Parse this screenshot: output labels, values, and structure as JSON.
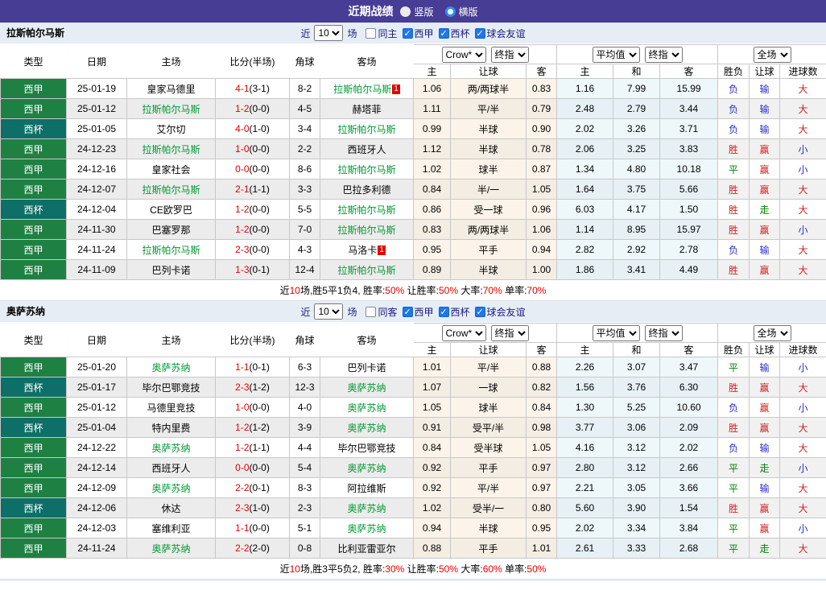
{
  "titlebar": {
    "title": "近期战绩",
    "radios": [
      {
        "label": "竖版",
        "selected": false
      },
      {
        "label": "横版",
        "selected": true
      }
    ]
  },
  "table_header": {
    "type": "类型",
    "date": "日期",
    "home": "主场",
    "score": "比分(半场)",
    "corner": "角球",
    "away": "客场",
    "group_selects": {
      "book": "Crow*",
      "book_stage": "终指",
      "avg": "平均值",
      "avg_stage": "终指",
      "scope": "全场"
    },
    "odds_sub": [
      "主",
      "让球",
      "客"
    ],
    "avg_sub": [
      "主",
      "和",
      "客"
    ],
    "result_sub": [
      "胜负",
      "让球",
      "进球数"
    ]
  },
  "result_color_map": {
    "胜": "#CC2222",
    "赢": "#CC2222",
    "大": "#CC2222",
    "平": "#008000",
    "走": "#008000",
    "负": "#2A2ACC",
    "输": "#2A2ACC",
    "小": "#2A2ACC"
  },
  "type_color_map": {
    "西甲": "#1E8143",
    "西杯": "#0E6F68"
  },
  "sections": [
    {
      "team": "拉斯帕尔马斯",
      "filter": {
        "near": "近",
        "count": "10",
        "unit": "场",
        "checks": [
          {
            "label": "同主",
            "checked": false
          },
          {
            "label": "西甲",
            "checked": true
          },
          {
            "label": "西杯",
            "checked": true
          },
          {
            "label": "球会友谊",
            "checked": true
          }
        ]
      },
      "rows": [
        {
          "type": "西甲",
          "date": "25-01-19",
          "home": "皇家马德里",
          "home_self": false,
          "home_badge": "",
          "score": "4-1",
          "half": "(3-1)",
          "corner": "8-2",
          "away": "拉斯帕尔马斯",
          "away_self": true,
          "away_badge": "1",
          "odds": [
            "1.06",
            "两/两球半",
            "0.83"
          ],
          "avg": [
            "1.16",
            "7.99",
            "15.99"
          ],
          "res": [
            "负",
            "输",
            "大"
          ]
        },
        {
          "type": "西甲",
          "date": "25-01-12",
          "home": "拉斯帕尔马斯",
          "home_self": true,
          "home_badge": "",
          "score": "1-2",
          "half": "(0-0)",
          "corner": "4-5",
          "away": "赫塔菲",
          "away_self": false,
          "away_badge": "",
          "odds": [
            "1.11",
            "平/半",
            "0.79"
          ],
          "avg": [
            "2.48",
            "2.79",
            "3.44"
          ],
          "res": [
            "负",
            "输",
            "大"
          ]
        },
        {
          "type": "西杯",
          "date": "25-01-05",
          "home": "艾尔切",
          "home_self": false,
          "home_badge": "",
          "score": "4-0",
          "half": "(1-0)",
          "corner": "3-4",
          "away": "拉斯帕尔马斯",
          "away_self": true,
          "away_badge": "",
          "odds": [
            "0.99",
            "半球",
            "0.90"
          ],
          "avg": [
            "2.02",
            "3.26",
            "3.71"
          ],
          "res": [
            "负",
            "输",
            "大"
          ]
        },
        {
          "type": "西甲",
          "date": "24-12-23",
          "home": "拉斯帕尔马斯",
          "home_self": true,
          "home_badge": "",
          "score": "1-0",
          "half": "(0-0)",
          "corner": "2-2",
          "away": "西班牙人",
          "away_self": false,
          "away_badge": "",
          "odds": [
            "1.12",
            "半球",
            "0.78"
          ],
          "avg": [
            "2.06",
            "3.25",
            "3.83"
          ],
          "res": [
            "胜",
            "赢",
            "小"
          ]
        },
        {
          "type": "西甲",
          "date": "24-12-16",
          "home": "皇家社会",
          "home_self": false,
          "home_badge": "",
          "score": "0-0",
          "half": "(0-0)",
          "corner": "8-6",
          "away": "拉斯帕尔马斯",
          "away_self": true,
          "away_badge": "",
          "odds": [
            "1.02",
            "球半",
            "0.87"
          ],
          "avg": [
            "1.34",
            "4.80",
            "10.18"
          ],
          "res": [
            "平",
            "赢",
            "小"
          ]
        },
        {
          "type": "西甲",
          "date": "24-12-07",
          "home": "拉斯帕尔马斯",
          "home_self": true,
          "home_badge": "",
          "score": "2-1",
          "half": "(1-1)",
          "corner": "3-3",
          "away": "巴拉多利德",
          "away_self": false,
          "away_badge": "",
          "odds": [
            "0.84",
            "半/一",
            "1.05"
          ],
          "avg": [
            "1.64",
            "3.75",
            "5.66"
          ],
          "res": [
            "胜",
            "赢",
            "大"
          ]
        },
        {
          "type": "西杯",
          "date": "24-12-04",
          "home": "CE欧罗巴",
          "home_self": false,
          "home_badge": "",
          "score": "1-2",
          "half": "(0-0)",
          "corner": "5-5",
          "away": "拉斯帕尔马斯",
          "away_self": true,
          "away_badge": "",
          "odds": [
            "0.86",
            "受一球",
            "0.96"
          ],
          "avg": [
            "6.03",
            "4.17",
            "1.50"
          ],
          "res": [
            "胜",
            "走",
            "大"
          ]
        },
        {
          "type": "西甲",
          "date": "24-11-30",
          "home": "巴塞罗那",
          "home_self": false,
          "home_badge": "",
          "score": "1-2",
          "half": "(0-0)",
          "corner": "7-0",
          "away": "拉斯帕尔马斯",
          "away_self": true,
          "away_badge": "",
          "odds": [
            "0.83",
            "两/两球半",
            "1.06"
          ],
          "avg": [
            "1.14",
            "8.95",
            "15.97"
          ],
          "res": [
            "胜",
            "赢",
            "小"
          ]
        },
        {
          "type": "西甲",
          "date": "24-11-24",
          "home": "拉斯帕尔马斯",
          "home_self": true,
          "home_badge": "",
          "score": "2-3",
          "half": "(0-0)",
          "corner": "4-3",
          "away": "马洛卡",
          "away_self": false,
          "away_badge": "1",
          "odds": [
            "0.95",
            "平手",
            "0.94"
          ],
          "avg": [
            "2.82",
            "2.92",
            "2.78"
          ],
          "res": [
            "负",
            "输",
            "大"
          ]
        },
        {
          "type": "西甲",
          "date": "24-11-09",
          "home": "巴列卡诺",
          "home_self": false,
          "home_badge": "",
          "score": "1-3",
          "half": "(0-1)",
          "corner": "12-4",
          "away": "拉斯帕尔马斯",
          "away_self": true,
          "away_badge": "",
          "odds": [
            "0.89",
            "半球",
            "1.00"
          ],
          "avg": [
            "1.86",
            "3.41",
            "4.49"
          ],
          "res": [
            "胜",
            "赢",
            "大"
          ]
        }
      ],
      "summary": [
        {
          "t": "近",
          "c": "k"
        },
        {
          "t": "10",
          "c": "r"
        },
        {
          "t": "场,胜5平1负4, 胜率:",
          "c": "k"
        },
        {
          "t": "50%",
          "c": "r"
        },
        {
          "t": " 让胜率:",
          "c": "k"
        },
        {
          "t": "50%",
          "c": "r"
        },
        {
          "t": " 大率:",
          "c": "k"
        },
        {
          "t": "70%",
          "c": "r"
        },
        {
          "t": " 单率:",
          "c": "k"
        },
        {
          "t": "70%",
          "c": "r"
        }
      ]
    },
    {
      "team": "奥萨苏纳",
      "filter": {
        "near": "近",
        "count": "10",
        "unit": "场",
        "checks": [
          {
            "label": "同客",
            "checked": false
          },
          {
            "label": "西甲",
            "checked": true
          },
          {
            "label": "西杯",
            "checked": true
          },
          {
            "label": "球会友谊",
            "checked": true
          }
        ]
      },
      "rows": [
        {
          "type": "西甲",
          "date": "25-01-20",
          "home": "奥萨苏纳",
          "home_self": true,
          "home_badge": "",
          "score": "1-1",
          "half": "(0-1)",
          "corner": "6-3",
          "away": "巴列卡诺",
          "away_self": false,
          "away_badge": "",
          "odds": [
            "1.01",
            "平/半",
            "0.88"
          ],
          "avg": [
            "2.26",
            "3.07",
            "3.47"
          ],
          "res": [
            "平",
            "输",
            "小"
          ]
        },
        {
          "type": "西杯",
          "date": "25-01-17",
          "home": "毕尔巴鄂竞技",
          "home_self": false,
          "home_badge": "",
          "score": "2-3",
          "half": "(1-2)",
          "corner": "12-3",
          "away": "奥萨苏纳",
          "away_self": true,
          "away_badge": "",
          "odds": [
            "1.07",
            "一球",
            "0.82"
          ],
          "avg": [
            "1.56",
            "3.76",
            "6.30"
          ],
          "res": [
            "胜",
            "赢",
            "大"
          ]
        },
        {
          "type": "西甲",
          "date": "25-01-12",
          "home": "马德里竞技",
          "home_self": false,
          "home_badge": "",
          "score": "1-0",
          "half": "(0-0)",
          "corner": "4-0",
          "away": "奥萨苏纳",
          "away_self": true,
          "away_badge": "",
          "odds": [
            "1.05",
            "球半",
            "0.84"
          ],
          "avg": [
            "1.30",
            "5.25",
            "10.60"
          ],
          "res": [
            "负",
            "赢",
            "小"
          ]
        },
        {
          "type": "西杯",
          "date": "25-01-04",
          "home": "特内里费",
          "home_self": false,
          "home_badge": "",
          "score": "1-2",
          "half": "(1-2)",
          "corner": "3-9",
          "away": "奥萨苏纳",
          "away_self": true,
          "away_badge": "",
          "odds": [
            "0.91",
            "受平/半",
            "0.98"
          ],
          "avg": [
            "3.77",
            "3.06",
            "2.09"
          ],
          "res": [
            "胜",
            "赢",
            "大"
          ]
        },
        {
          "type": "西甲",
          "date": "24-12-22",
          "home": "奥萨苏纳",
          "home_self": true,
          "home_badge": "",
          "score": "1-2",
          "half": "(1-1)",
          "corner": "4-4",
          "away": "毕尔巴鄂竞技",
          "away_self": false,
          "away_badge": "",
          "odds": [
            "0.84",
            "受半球",
            "1.05"
          ],
          "avg": [
            "4.16",
            "3.12",
            "2.02"
          ],
          "res": [
            "负",
            "输",
            "大"
          ]
        },
        {
          "type": "西甲",
          "date": "24-12-14",
          "home": "西班牙人",
          "home_self": false,
          "home_badge": "",
          "score": "0-0",
          "half": "(0-0)",
          "corner": "5-4",
          "away": "奥萨苏纳",
          "away_self": true,
          "away_badge": "",
          "odds": [
            "0.92",
            "平手",
            "0.97"
          ],
          "avg": [
            "2.80",
            "3.12",
            "2.66"
          ],
          "res": [
            "平",
            "走",
            "小"
          ]
        },
        {
          "type": "西甲",
          "date": "24-12-09",
          "home": "奥萨苏纳",
          "home_self": true,
          "home_badge": "",
          "score": "2-2",
          "half": "(0-1)",
          "corner": "8-3",
          "away": "阿拉维斯",
          "away_self": false,
          "away_badge": "",
          "odds": [
            "0.92",
            "平/半",
            "0.97"
          ],
          "avg": [
            "2.21",
            "3.05",
            "3.66"
          ],
          "res": [
            "平",
            "输",
            "大"
          ]
        },
        {
          "type": "西杯",
          "date": "24-12-06",
          "home": "休达",
          "home_self": false,
          "home_badge": "",
          "score": "2-3",
          "half": "(1-0)",
          "corner": "2-3",
          "away": "奥萨苏纳",
          "away_self": true,
          "away_badge": "",
          "odds": [
            "1.02",
            "受半/一",
            "0.80"
          ],
          "avg": [
            "5.60",
            "3.90",
            "1.54"
          ],
          "res": [
            "胜",
            "赢",
            "大"
          ]
        },
        {
          "type": "西甲",
          "date": "24-12-03",
          "home": "塞维利亚",
          "home_self": false,
          "home_badge": "",
          "score": "1-1",
          "half": "(0-0)",
          "corner": "5-1",
          "away": "奥萨苏纳",
          "away_self": true,
          "away_badge": "",
          "odds": [
            "0.94",
            "半球",
            "0.95"
          ],
          "avg": [
            "2.02",
            "3.34",
            "3.84"
          ],
          "res": [
            "平",
            "赢",
            "小"
          ]
        },
        {
          "type": "西甲",
          "date": "24-11-24",
          "home": "奥萨苏纳",
          "home_self": true,
          "home_badge": "",
          "score": "2-2",
          "half": "(2-0)",
          "corner": "0-8",
          "away": "比利亚雷亚尔",
          "away_self": false,
          "away_badge": "",
          "odds": [
            "0.88",
            "平手",
            "1.01"
          ],
          "avg": [
            "2.61",
            "3.33",
            "2.68"
          ],
          "res": [
            "平",
            "走",
            "大"
          ]
        }
      ],
      "summary": [
        {
          "t": "近",
          "c": "k"
        },
        {
          "t": "10",
          "c": "r"
        },
        {
          "t": "场,胜3平5负2, 胜率:",
          "c": "k"
        },
        {
          "t": "30%",
          "c": "r"
        },
        {
          "t": " 让胜率:",
          "c": "k"
        },
        {
          "t": "50%",
          "c": "r"
        },
        {
          "t": " 大率:",
          "c": "k"
        },
        {
          "t": "60%",
          "c": "r"
        },
        {
          "t": " 单率:",
          "c": "k"
        },
        {
          "t": "50%",
          "c": "r"
        }
      ]
    }
  ]
}
